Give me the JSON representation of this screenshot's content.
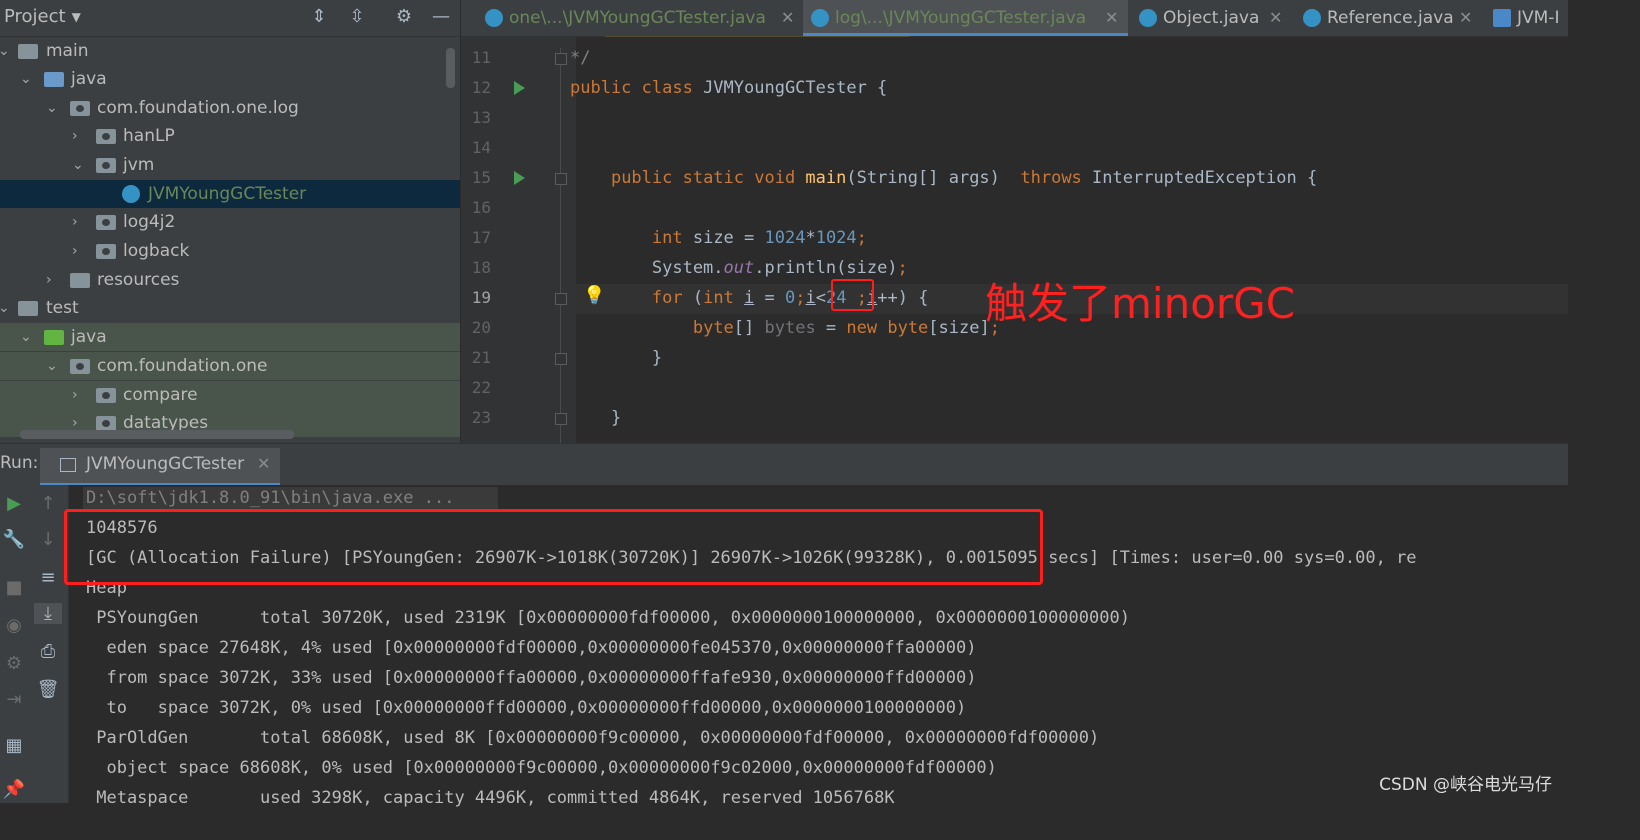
{
  "project_panel": {
    "title": "Project",
    "tree": [
      {
        "label": "main",
        "depth": 0,
        "type": "folder",
        "expanded": true
      },
      {
        "label": "java",
        "depth": 1,
        "type": "folder-src",
        "expanded": true
      },
      {
        "label": "com.foundation.one.log",
        "depth": 2,
        "type": "package",
        "expanded": true
      },
      {
        "label": "hanLP",
        "depth": 3,
        "type": "package",
        "expanded": false
      },
      {
        "label": "jvm",
        "depth": 3,
        "type": "package",
        "expanded": true
      },
      {
        "label": "JVMYoungGCTester",
        "depth": 4,
        "type": "class",
        "selected": true
      },
      {
        "label": "log4j2",
        "depth": 3,
        "type": "package",
        "expanded": false
      },
      {
        "label": "logback",
        "depth": 3,
        "type": "package",
        "expanded": false
      },
      {
        "label": "resources",
        "depth": 2,
        "type": "folder",
        "expanded": false
      },
      {
        "label": "test",
        "depth": 0,
        "type": "folder",
        "expanded": true
      },
      {
        "label": "java",
        "depth": 1,
        "type": "folder-test",
        "expanded": true
      },
      {
        "label": "com.foundation.one",
        "depth": 2,
        "type": "package",
        "expanded": true
      },
      {
        "label": "compare",
        "depth": 3,
        "type": "package",
        "expanded": false
      },
      {
        "label": "datatypes",
        "depth": 3,
        "type": "package",
        "expanded": false
      }
    ]
  },
  "tabs": [
    {
      "label": "one\\...\\JVMYoungGCTester.java",
      "modified": true
    },
    {
      "label": "log\\...\\JVMYoungGCTester.java",
      "modified": true,
      "active": true
    },
    {
      "label": "Object.java"
    },
    {
      "label": "Reference.java"
    },
    {
      "label": "JVM-I"
    }
  ],
  "editor": {
    "line_numbers": [
      "11",
      "12",
      "13",
      "14",
      "15",
      "16",
      "17",
      "18",
      "19",
      "20",
      "21",
      "22",
      "23"
    ],
    "current_line": "19"
  },
  "annotation": {
    "label": "触发了minorGC"
  },
  "run_panel": {
    "label": "Run:",
    "tab_label": "JVMYoungGCTester",
    "console": [
      "D:\\soft\\jdk1.8.0_91\\bin\\java.exe ...",
      "1048576",
      "[GC (Allocation Failure) [PSYoungGen: 26907K->1018K(30720K)] 26907K->1026K(99328K), 0.0015095 secs] [Times: user=0.00 sys=0.00, re",
      "Heap",
      " PSYoungGen      total 30720K, used 2319K [0x00000000fdf00000, 0x0000000100000000, 0x0000000100000000)",
      "  eden space 27648K, 4% used [0x00000000fdf00000,0x00000000fe045370,0x00000000ffa00000)",
      "  from space 3072K, 33% used [0x00000000ffa00000,0x00000000ffafe930,0x00000000ffd00000)",
      "  to   space 3072K, 0% used [0x00000000ffd00000,0x00000000ffd00000,0x0000000100000000)",
      " ParOldGen       total 68608K, used 8K [0x00000000f9c00000, 0x00000000fdf00000, 0x00000000fdf00000)",
      "  object space 68608K, 0% used [0x00000000f9c00000,0x00000000f9c02000,0x00000000fdf00000)",
      " Metaspace       used 3298K, capacity 4496K, committed 4864K, reserved 1056768K"
    ]
  },
  "watermark": "CSDN @峡谷电光马仔",
  "colors": {
    "annotation_red": "#ff1e1e",
    "keyword": "#cc7832",
    "number": "#6897bb",
    "method": "#ffc66d"
  }
}
